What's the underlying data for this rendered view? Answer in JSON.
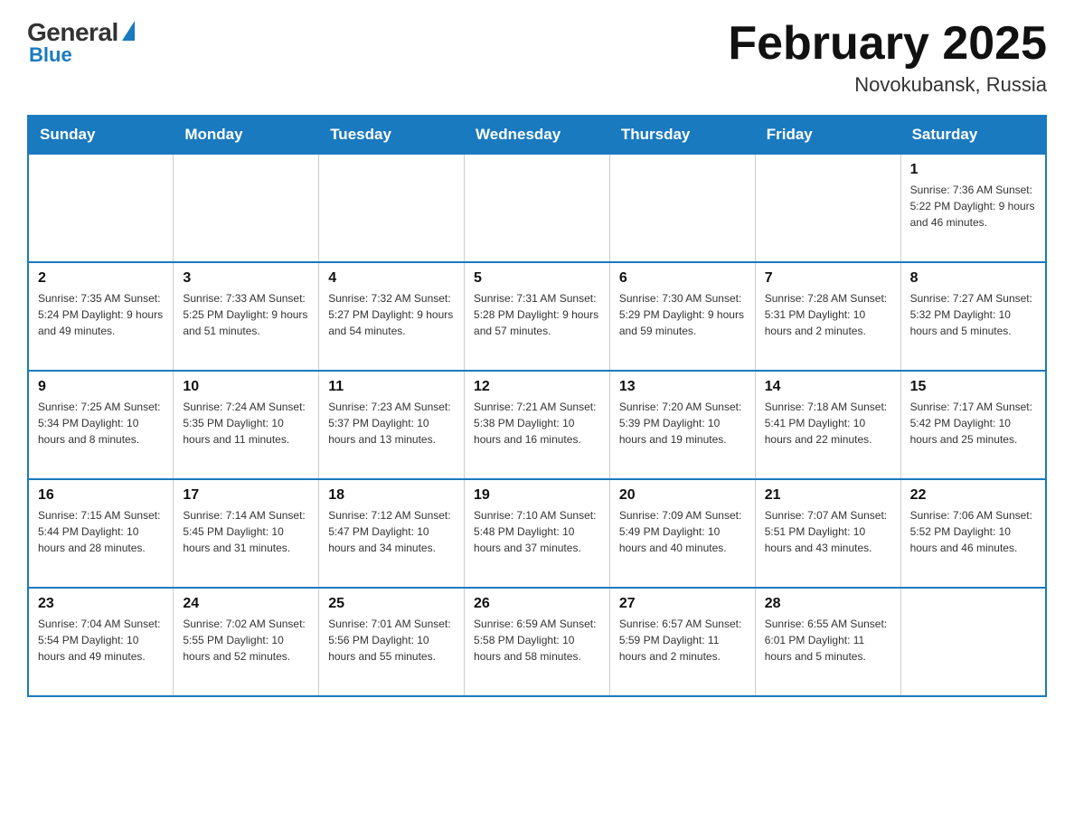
{
  "logo": {
    "general": "General",
    "blue": "Blue"
  },
  "title": "February 2025",
  "subtitle": "Novokubansk, Russia",
  "weekdays": [
    "Sunday",
    "Monday",
    "Tuesday",
    "Wednesday",
    "Thursday",
    "Friday",
    "Saturday"
  ],
  "weeks": [
    [
      {
        "day": "",
        "info": ""
      },
      {
        "day": "",
        "info": ""
      },
      {
        "day": "",
        "info": ""
      },
      {
        "day": "",
        "info": ""
      },
      {
        "day": "",
        "info": ""
      },
      {
        "day": "",
        "info": ""
      },
      {
        "day": "1",
        "info": "Sunrise: 7:36 AM\nSunset: 5:22 PM\nDaylight: 9 hours\nand 46 minutes."
      }
    ],
    [
      {
        "day": "2",
        "info": "Sunrise: 7:35 AM\nSunset: 5:24 PM\nDaylight: 9 hours\nand 49 minutes."
      },
      {
        "day": "3",
        "info": "Sunrise: 7:33 AM\nSunset: 5:25 PM\nDaylight: 9 hours\nand 51 minutes."
      },
      {
        "day": "4",
        "info": "Sunrise: 7:32 AM\nSunset: 5:27 PM\nDaylight: 9 hours\nand 54 minutes."
      },
      {
        "day": "5",
        "info": "Sunrise: 7:31 AM\nSunset: 5:28 PM\nDaylight: 9 hours\nand 57 minutes."
      },
      {
        "day": "6",
        "info": "Sunrise: 7:30 AM\nSunset: 5:29 PM\nDaylight: 9 hours\nand 59 minutes."
      },
      {
        "day": "7",
        "info": "Sunrise: 7:28 AM\nSunset: 5:31 PM\nDaylight: 10 hours\nand 2 minutes."
      },
      {
        "day": "8",
        "info": "Sunrise: 7:27 AM\nSunset: 5:32 PM\nDaylight: 10 hours\nand 5 minutes."
      }
    ],
    [
      {
        "day": "9",
        "info": "Sunrise: 7:25 AM\nSunset: 5:34 PM\nDaylight: 10 hours\nand 8 minutes."
      },
      {
        "day": "10",
        "info": "Sunrise: 7:24 AM\nSunset: 5:35 PM\nDaylight: 10 hours\nand 11 minutes."
      },
      {
        "day": "11",
        "info": "Sunrise: 7:23 AM\nSunset: 5:37 PM\nDaylight: 10 hours\nand 13 minutes."
      },
      {
        "day": "12",
        "info": "Sunrise: 7:21 AM\nSunset: 5:38 PM\nDaylight: 10 hours\nand 16 minutes."
      },
      {
        "day": "13",
        "info": "Sunrise: 7:20 AM\nSunset: 5:39 PM\nDaylight: 10 hours\nand 19 minutes."
      },
      {
        "day": "14",
        "info": "Sunrise: 7:18 AM\nSunset: 5:41 PM\nDaylight: 10 hours\nand 22 minutes."
      },
      {
        "day": "15",
        "info": "Sunrise: 7:17 AM\nSunset: 5:42 PM\nDaylight: 10 hours\nand 25 minutes."
      }
    ],
    [
      {
        "day": "16",
        "info": "Sunrise: 7:15 AM\nSunset: 5:44 PM\nDaylight: 10 hours\nand 28 minutes."
      },
      {
        "day": "17",
        "info": "Sunrise: 7:14 AM\nSunset: 5:45 PM\nDaylight: 10 hours\nand 31 minutes."
      },
      {
        "day": "18",
        "info": "Sunrise: 7:12 AM\nSunset: 5:47 PM\nDaylight: 10 hours\nand 34 minutes."
      },
      {
        "day": "19",
        "info": "Sunrise: 7:10 AM\nSunset: 5:48 PM\nDaylight: 10 hours\nand 37 minutes."
      },
      {
        "day": "20",
        "info": "Sunrise: 7:09 AM\nSunset: 5:49 PM\nDaylight: 10 hours\nand 40 minutes."
      },
      {
        "day": "21",
        "info": "Sunrise: 7:07 AM\nSunset: 5:51 PM\nDaylight: 10 hours\nand 43 minutes."
      },
      {
        "day": "22",
        "info": "Sunrise: 7:06 AM\nSunset: 5:52 PM\nDaylight: 10 hours\nand 46 minutes."
      }
    ],
    [
      {
        "day": "23",
        "info": "Sunrise: 7:04 AM\nSunset: 5:54 PM\nDaylight: 10 hours\nand 49 minutes."
      },
      {
        "day": "24",
        "info": "Sunrise: 7:02 AM\nSunset: 5:55 PM\nDaylight: 10 hours\nand 52 minutes."
      },
      {
        "day": "25",
        "info": "Sunrise: 7:01 AM\nSunset: 5:56 PM\nDaylight: 10 hours\nand 55 minutes."
      },
      {
        "day": "26",
        "info": "Sunrise: 6:59 AM\nSunset: 5:58 PM\nDaylight: 10 hours\nand 58 minutes."
      },
      {
        "day": "27",
        "info": "Sunrise: 6:57 AM\nSunset: 5:59 PM\nDaylight: 11 hours\nand 2 minutes."
      },
      {
        "day": "28",
        "info": "Sunrise: 6:55 AM\nSunset: 6:01 PM\nDaylight: 11 hours\nand 5 minutes."
      },
      {
        "day": "",
        "info": ""
      }
    ]
  ]
}
